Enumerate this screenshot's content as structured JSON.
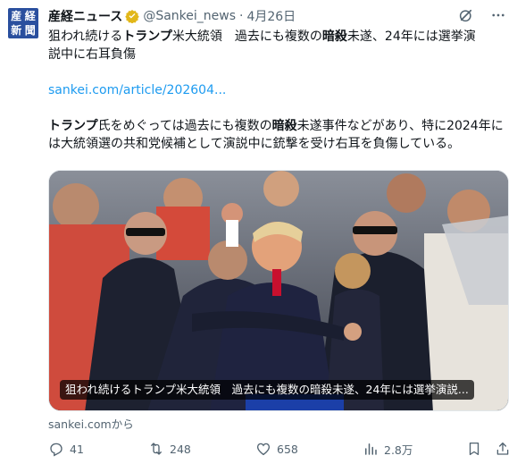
{
  "account": {
    "avatar_chars": [
      "産",
      "経",
      "新",
      "聞"
    ],
    "name": "産経ニュース",
    "handle": "@Sankei_news",
    "separator": "·",
    "date": "4月26日"
  },
  "tweet": {
    "line1_prefix": "狙われ続ける",
    "line1_bold": "トランプ",
    "line1_mid": "米大統領　過去にも複数の",
    "line1_bold2": "暗殺",
    "line1_suffix": "未遂、24年には選挙演",
    "line2": "説中に右耳負傷",
    "link": "sankei.com/article/202604...",
    "para_bold": "トランプ",
    "para_a": "氏をめぐっては過去にも複数の",
    "para_bold2": "暗殺",
    "para_b": "未遂事件などがあり、特に2024年には大統領選の共和党候補として演説中に銃撃を受け右耳を負傷している。"
  },
  "card": {
    "caption": "狙われ続けるトランプ米大統領　過去にも複数の暗殺未遂、24年には選挙演説...",
    "source": "sankei.comから"
  },
  "stats": {
    "replies": "41",
    "reposts": "248",
    "likes": "658",
    "views": "2.8万"
  },
  "icons": [
    "grok-icon",
    "more-icon",
    "verified-badge-icon",
    "reply-icon",
    "repost-icon",
    "like-icon",
    "views-icon",
    "bookmark-icon",
    "share-icon"
  ],
  "colors": {
    "accent_link": "#1d9bf0",
    "muted": "#536471",
    "badge_gold": "#e2b719",
    "avatar_bg": "#2a4f9e"
  }
}
